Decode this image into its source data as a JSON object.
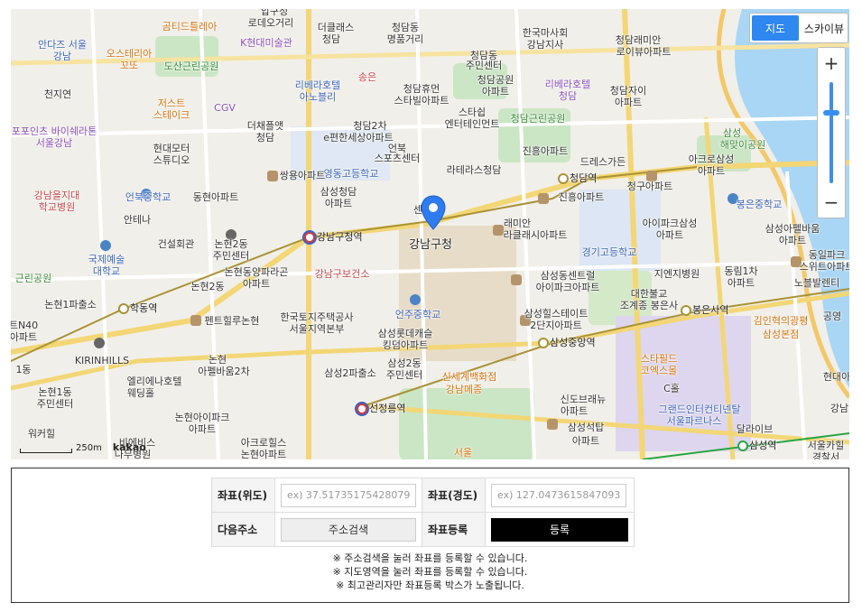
{
  "map": {
    "type_toggle": {
      "map_label": "지도",
      "skyview_label": "스카이뷰"
    },
    "zoom": {
      "in_label": "+",
      "out_label": "−",
      "level_fraction": 0.3
    },
    "scale": {
      "distance": "250m",
      "logo": "kakao"
    },
    "marker_label": "강남구청",
    "stations": [
      {
        "name": "강남구청역"
      },
      {
        "name": "청담역"
      },
      {
        "name": "학동역"
      },
      {
        "name": "봉은사역"
      },
      {
        "name": "삼성중앙역"
      },
      {
        "name": "선정릉역"
      },
      {
        "name": "삼성역"
      }
    ],
    "labels": {
      "l1": "압구정",
      "l2": "로데오거리",
      "l3": "더클래스",
      "l4": "청담",
      "l5": "청담동",
      "l6": "명품거리",
      "l7": "한국마사회",
      "l8": "강남지사",
      "l9": "곰티드틀레아",
      "l10": "K현대미술관",
      "l11": "안다즈 서울",
      "l12": "강남",
      "l13": "오스테리아",
      "l14": "꼬또",
      "l15": "도산근린공원",
      "l16": "리베라호텔",
      "l17": "아노블리",
      "l18": "송은",
      "l19": "청담휴먼",
      "l20": "스타빌아파트",
      "l21": "청담동",
      "l22": "주민센터",
      "l23": "청담공원",
      "l24": "아파트",
      "l25": "리베라호텔",
      "l26": "청담",
      "l27": "청담래미안",
      "l28": "로이뷰아파트",
      "l29": "청담자이",
      "l30": "아파트",
      "l31": "천지연",
      "l32": "저스트",
      "l33": "스테이크",
      "l34": "CGV",
      "l35": "더채플앳",
      "l36": "청담",
      "l37": "청담2차",
      "l38": "e편한세상아파트",
      "l39": "스타쉽",
      "l40": "엔터테인먼트",
      "l41": "청담근린공원",
      "l42": "진흥아파트",
      "l43": "삼성",
      "l44": "해맞이공원",
      "l45": "포포인츠 바이쉐라톤",
      "l46": "서울강남",
      "l47": "현대모터",
      "l48": "스튜디오",
      "l49": "영동고등학교",
      "l50": "언북",
      "l51": "스포츠센터",
      "l52": "라테라스청담",
      "l53": "드레스가든",
      "l54": "아크로삼성",
      "l55": "아파트",
      "l56": "쌍용아파트",
      "l57": "강남을지대",
      "l58": "학교병원",
      "l59": "언북중학교",
      "l60": "동현아파트",
      "l61": "삼성청담",
      "l62": "아파트",
      "l63": "진흥아파트",
      "l64": "청구아파트",
      "l65": "봉은중학교",
      "l66": "안테나",
      "l67": "강남구청",
      "l68": "래미안",
      "l69": "라클래시아파트",
      "l70": "아이파크삼성",
      "l71": "아파트",
      "l72": "삼성아펠바움",
      "l73": "아파트",
      "l74": "건설회관",
      "l75": "논현2동",
      "l76": "주민센터",
      "l77": "국제예술",
      "l78": "대학교",
      "l79": "경기고등학교",
      "l80": "동일파크",
      "l81": "스위트아파트",
      "l82": "논현동양파라곤",
      "l83": "아파트",
      "l84": "강남구보건소",
      "l85": "삼성동센트럴",
      "l86": "아이파크아파트",
      "l87": "지엔지병원",
      "l88": "동림1차",
      "l89": "아파트",
      "l90": "노블발렌티",
      "l91": "근린공원",
      "l92": "논현2동",
      "l93": "논현1파출소",
      "l94": "언주중학교",
      "l95": "대한불교",
      "l96": "조계종 봉은사",
      "l97": "김인혁의광평",
      "l98": "삼성본점",
      "l99": "공영",
      "l100": "펜트힐루논현",
      "l101": "한국토지주택공사",
      "l102": "서울지역본부",
      "l103": "삼성힐스테이트",
      "l104": "2단지아파트",
      "l105": "삼성롯데캐슬",
      "l106": "킹덤아파트",
      "l107": "트N40",
      "l108": "아파트",
      "l109": "KIRINHILLS",
      "l110": "논현",
      "l111": "아펠바움2차",
      "l112": "삼성2동",
      "l113": "주민센터",
      "l114": "삼성2파출소",
      "l115": "신세계백화점",
      "l116": "강남메종",
      "l117": "스타필드",
      "l118": "코엑스몰",
      "l119": "현대아",
      "l120": "1동",
      "l121": "엘리에나호텔",
      "l122": "웨딩홀",
      "l123": "논현1동",
      "l124": "주민센터",
      "l125": "C홀",
      "l126": "신도브래뉴",
      "l127": "아파트",
      "l128": "그랜드인터컨티넨탈",
      "l129": "서울파르나스",
      "l130": "강남",
      "l131": "논현아이파크",
      "l132": "아파트",
      "l133": "삼성석탑",
      "l134": "아파트",
      "l135": "달라이브",
      "l136": "워커힐",
      "l137": "비에비스",
      "l138": "나무병원",
      "l139": "아크로힐스",
      "l140": "논현아파트",
      "l141": "서울",
      "l142": "서울카힐",
      "l143": "경찰서",
      "l144": "센터"
    }
  },
  "form": {
    "lat_label": "좌표(위도)",
    "lat_placeholder": "ex) 37.51735175428079",
    "lng_label": "좌표(경도)",
    "lng_placeholder": "ex) 127.04736158470936",
    "addr_label": "다음주소",
    "addr_button": "주소검색",
    "register_label": "좌표등록",
    "register_button": "등록"
  },
  "notes": [
    "※ 주소검색을 눌러 좌표를 등록할 수 있습니다.",
    "※ 지도영역을 눌러 좌표를 등록할 수 있습니다.",
    "※ 최고관리자만 좌표등록 박스가 노출됩니다."
  ],
  "colors": {
    "toggle_active": "#2f87f0",
    "register_bg": "#000000",
    "river": "#a9d6f5",
    "park": "#cbe6c4"
  }
}
